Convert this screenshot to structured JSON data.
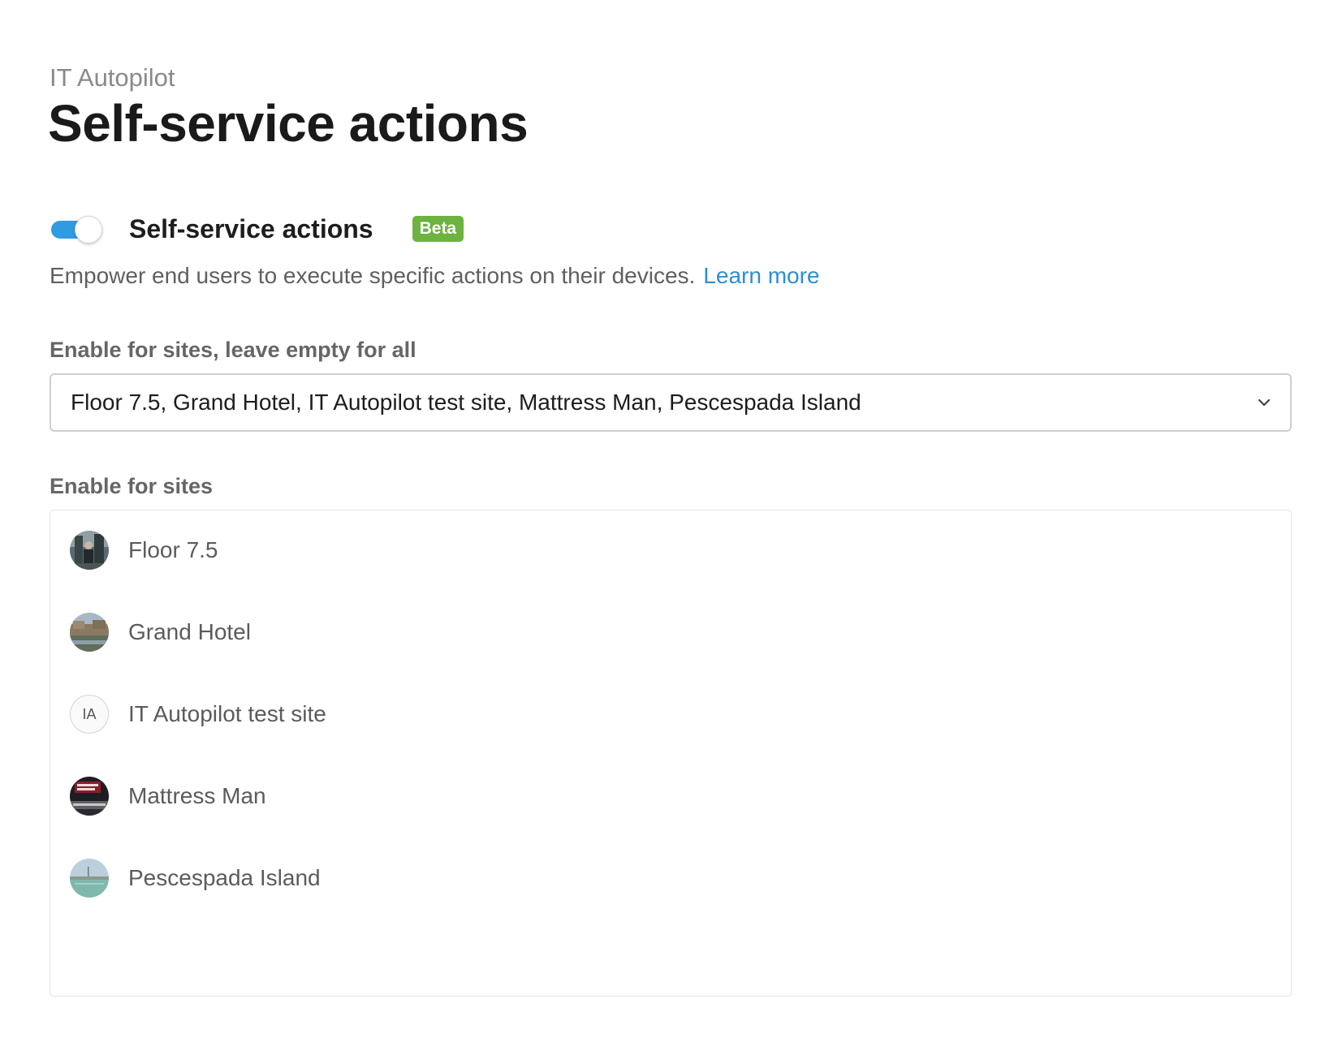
{
  "header": {
    "breadcrumb": "IT Autopilot",
    "title": "Self-service actions"
  },
  "feature": {
    "toggle_on": true,
    "label": "Self-service actions",
    "badge": "Beta",
    "description": "Empower end users to execute specific actions on their devices.",
    "learn_more": "Learn more"
  },
  "sites_select": {
    "label": "Enable for sites, leave empty for all",
    "value": "Floor 7.5, Grand Hotel, IT Autopilot test site, Mattress Man, Pescespada Island"
  },
  "sites_list": {
    "label": "Enable for sites",
    "items": [
      {
        "name": "Floor 7.5",
        "avatar": "photo"
      },
      {
        "name": "Grand Hotel",
        "avatar": "photo"
      },
      {
        "name": "IT Autopilot test site",
        "avatar": "initials",
        "initials": "IA"
      },
      {
        "name": "Mattress Man",
        "avatar": "photo"
      },
      {
        "name": "Pescespada Island",
        "avatar": "photo"
      }
    ]
  },
  "colors": {
    "accent": "#2e9be3",
    "badge": "#6cb33f",
    "link": "#2a8fd6"
  }
}
